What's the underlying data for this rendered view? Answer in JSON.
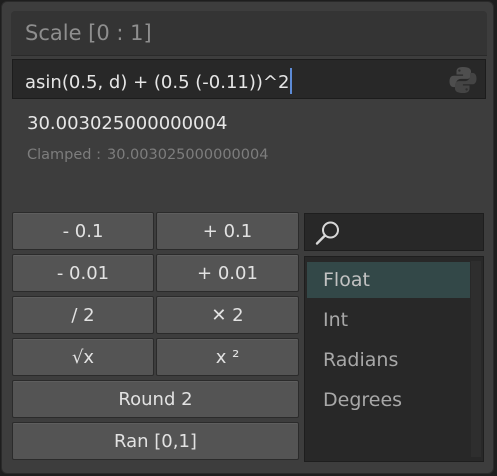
{
  "title": "Scale [0 : 1]",
  "expression": "asin(0.5, d) + (0.5 (-0.11))^2",
  "result": "30.003025000000004",
  "clamped": {
    "label": "Clamped :",
    "value": "30.003025000000004"
  },
  "buttons": {
    "minus_0_1": "- 0.1",
    "plus_0_1": "+ 0.1",
    "minus_0_01": "- 0.01",
    "plus_0_01": "+ 0.01",
    "divide_2": "/ 2",
    "times_2": "✕ 2",
    "sqrt": "√x",
    "square": "x ²",
    "round_2": "Round 2",
    "random": "Ran [0,1]"
  },
  "search": {
    "placeholder": ""
  },
  "types": {
    "selected": "Float",
    "items": [
      "Float",
      "Int",
      "Radians",
      "Degrees"
    ]
  },
  "icons": {
    "python": "python-icon",
    "search": "search-icon"
  },
  "colors": {
    "caret": "#5d8bd6",
    "selected_item_bg": "#334848"
  }
}
